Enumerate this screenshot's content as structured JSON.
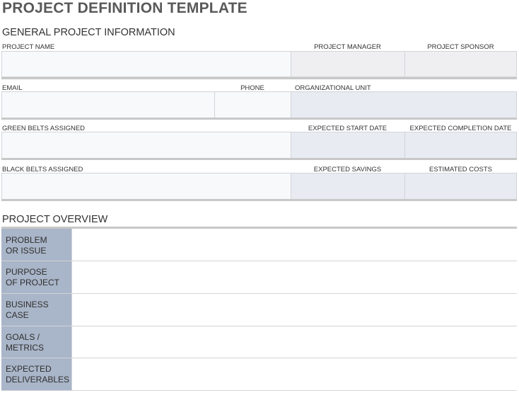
{
  "title": "PROJECT DEFINITION TEMPLATE",
  "general": {
    "heading": "GENERAL PROJECT INFORMATION",
    "rows": [
      {
        "labels": [
          "PROJECT NAME",
          "PROJECT MANAGER",
          "PROJECT SPONSOR"
        ]
      },
      {
        "labels": [
          "EMAIL",
          "PHONE",
          "ORGANIZATIONAL UNIT"
        ]
      },
      {
        "labels": [
          "GREEN BELTS ASSIGNED",
          "EXPECTED START DATE",
          "EXPECTED COMPLETION DATE"
        ]
      },
      {
        "labels": [
          "BLACK BELTS ASSIGNED",
          "EXPECTED SAVINGS",
          "ESTIMATED COSTS"
        ]
      }
    ]
  },
  "overview": {
    "heading": "PROJECT OVERVIEW",
    "rows": [
      {
        "label": "PROBLEM\nOR ISSUE",
        "value": ""
      },
      {
        "label": "PURPOSE\nOF PROJECT",
        "value": ""
      },
      {
        "label": "BUSINESS\nCASE",
        "value": ""
      },
      {
        "label": "GOALS /\nMETRICS",
        "value": ""
      },
      {
        "label": "EXPECTED\nDELIVERABLES",
        "value": ""
      }
    ]
  },
  "colors": {
    "title_text": "#595959",
    "label_band": "#a9b5c8",
    "field_white": "#f8f9fb",
    "field_grey": "#efeff1",
    "field_blue": "#e8ebf2"
  }
}
